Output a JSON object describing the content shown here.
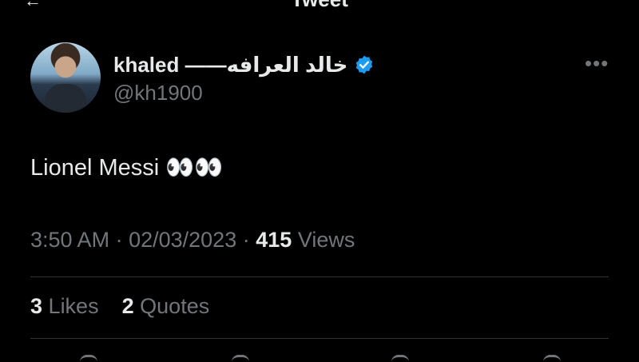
{
  "header": {
    "title": "Tweet",
    "back_icon": "arrow-left-icon"
  },
  "author": {
    "display_name": "khaled ——خالد العرافه",
    "handle": "@kh1900",
    "verified": true,
    "verified_color": "#1d9bf0"
  },
  "tweet": {
    "text": "Lionel Messi 👀👀"
  },
  "meta": {
    "time": "3:50 AM",
    "date": "02/03/2023",
    "views_count": "415",
    "views_label": "Views"
  },
  "stats": {
    "likes_count": "3",
    "likes_label": "Likes",
    "quotes_count": "2",
    "quotes_label": "Quotes"
  },
  "colors": {
    "background": "#000000",
    "text_primary": "#e7e9ea",
    "text_secondary": "#71767b",
    "divider": "#2f3336"
  }
}
